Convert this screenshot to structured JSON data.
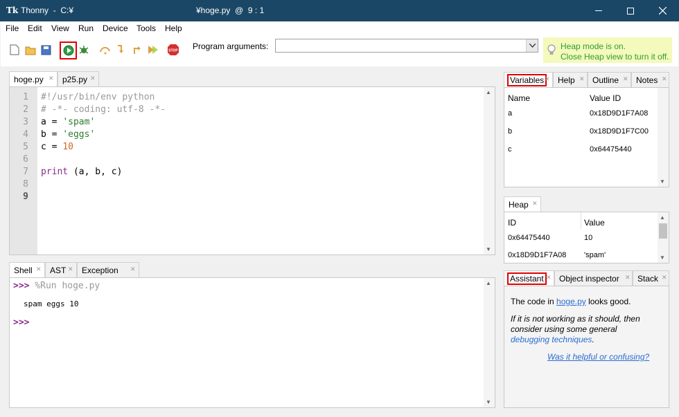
{
  "window": {
    "app_title": "Thonny  -  C:¥",
    "doc_title": "¥hoge.py  @  9 : 1",
    "app_icon": "Tk"
  },
  "menu": [
    "File",
    "Edit",
    "View",
    "Run",
    "Device",
    "Tools",
    "Help"
  ],
  "toolbar": {
    "program_arguments_label": "Program arguments:",
    "program_arguments_value": "",
    "icons": [
      "new-file-icon",
      "open-file-icon",
      "save-icon",
      "run-icon",
      "debug-icon",
      "step-over-icon",
      "step-into-icon",
      "step-out-icon",
      "resume-icon",
      "stop-icon"
    ],
    "stop_text": "STOP"
  },
  "heap_note": {
    "line1": "Heap mode is on.",
    "line2": "Close Heap view to turn it off.",
    "text_color": "#2f9e2f",
    "bg": "#f4f9bc"
  },
  "editor": {
    "tabs": [
      "hoge.py",
      "p25.py"
    ],
    "line_numbers": [
      "1",
      "2",
      "3",
      "4",
      "5",
      "6",
      "7",
      "8",
      "9"
    ],
    "lines": [
      [
        {
          "t": "#!/usr/bin/env python",
          "c": "comment"
        }
      ],
      [
        {
          "t": "# -*- coding: utf-8 -*-",
          "c": "comment"
        }
      ],
      [
        {
          "t": "a = ",
          "c": "plain"
        },
        {
          "t": "'spam'",
          "c": "string"
        }
      ],
      [
        {
          "t": "b = ",
          "c": "plain"
        },
        {
          "t": "'eggs'",
          "c": "string"
        }
      ],
      [
        {
          "t": "c = ",
          "c": "plain"
        },
        {
          "t": "10",
          "c": "number"
        }
      ],
      [],
      [
        {
          "t": "print",
          "c": "keyword"
        },
        {
          "t": " (a, b, c)",
          "c": "plain"
        }
      ],
      [],
      []
    ]
  },
  "shell": {
    "tabs": [
      "Shell",
      "AST",
      "Exception"
    ],
    "prompt": ">>>",
    "command": " %Run hoge.py",
    "output": "spam eggs 10"
  },
  "variables": {
    "tabs": [
      "Variables",
      "Help",
      "Outline",
      "Notes"
    ],
    "headers": [
      "Name",
      "Value ID"
    ],
    "rows": [
      [
        "a",
        "0x18D9D1F7A08"
      ],
      [
        "b",
        "0x18D9D1F7C00"
      ],
      [
        "c",
        "0x64475440"
      ]
    ]
  },
  "heap": {
    "tabs": [
      "Heap"
    ],
    "headers": [
      "ID",
      "Value"
    ],
    "rows": [
      [
        "0x64475440",
        "10"
      ],
      [
        "0x18D9D1F7A08",
        "'spam'"
      ]
    ]
  },
  "assistant": {
    "tabs": [
      "Assistant",
      "Object inspector",
      "Stack"
    ],
    "msg_prefix": "The code in ",
    "msg_link": "hoge.py",
    "msg_suffix": " looks good.",
    "italic1": "If it is not working as it should, then",
    "italic2": "consider using some general",
    "italic3_link": "debugging techniques",
    "italic3_end": ".",
    "feedback": "Was it helpful or confusing?"
  },
  "colors": {
    "titlebar": "#1b4766",
    "comment": "#999999",
    "string": "#2e7d32",
    "number": "#d2691e",
    "keyword": "#8b2a8b",
    "prompt": "#8b2a8b",
    "highlight": "#e00000"
  }
}
